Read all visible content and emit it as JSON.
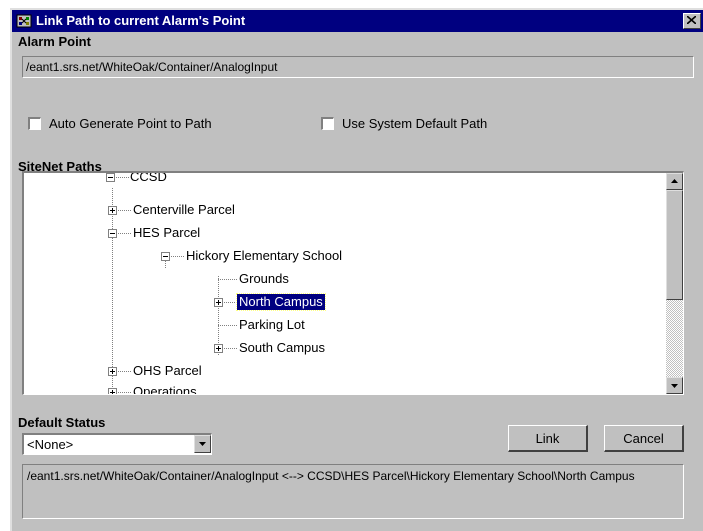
{
  "window": {
    "title": "Link Path to current Alarm's Point"
  },
  "alarm_point": {
    "label": "Alarm Point",
    "value": "/eant1.srs.net/WhiteOak/Container/AnalogInput"
  },
  "options": {
    "auto_generate": {
      "label": "Auto Generate Point to Path",
      "checked": false
    },
    "use_default": {
      "label": "Use System Default Path",
      "checked": false
    }
  },
  "sitenet": {
    "label": "SiteNet Paths",
    "nodes": {
      "ccsd": "CCSD",
      "centerville": "Centerville Parcel",
      "hes": "HES Parcel",
      "hickory": "Hickory Elementary School",
      "grounds": "Grounds",
      "north": "North Campus",
      "parking": "Parking Lot",
      "south": "South Campus",
      "ohs": "OHS Parcel",
      "operations": "Operations"
    },
    "selected": "North Campus"
  },
  "default_status": {
    "label": "Default Status",
    "value": "<None>"
  },
  "buttons": {
    "link": "Link",
    "cancel": "Cancel"
  },
  "result": {
    "text": "/eant1.srs.net/WhiteOak/Container/AnalogInput <--> CCSD\\HES Parcel\\Hickory Elementary School\\North Campus"
  }
}
